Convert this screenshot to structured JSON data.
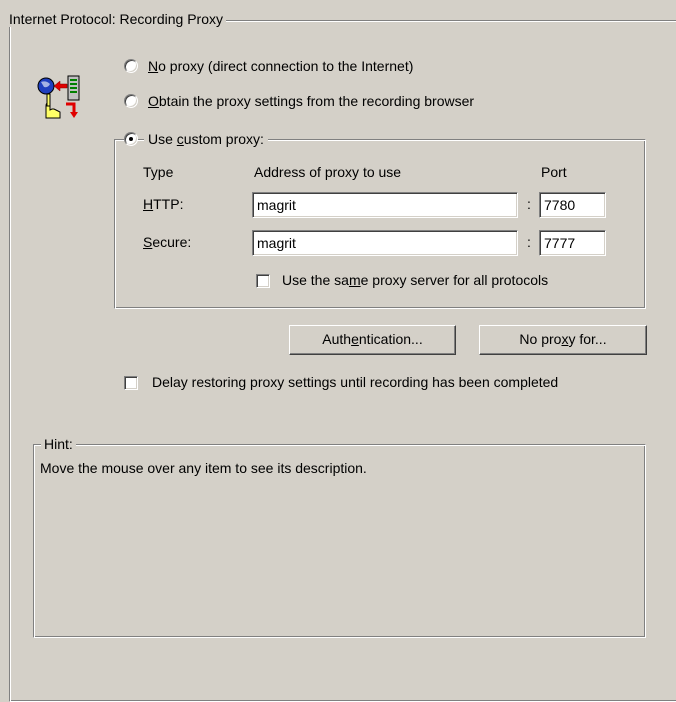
{
  "section": {
    "title": "Internet Protocol: Recording Proxy"
  },
  "icon": {
    "name": "proxy-settings-icon"
  },
  "proxy_mode": {
    "no_proxy": {
      "label_accel": "N",
      "label_rest": "o proxy (direct connection to the Internet)",
      "selected": false
    },
    "obtain_from_browser": {
      "label_accel": "O",
      "label_rest": "btain the proxy settings from the recording browser",
      "selected": false
    },
    "custom": {
      "label_prefix": "Use ",
      "label_accel": "c",
      "label_rest": "ustom proxy:",
      "selected": true
    }
  },
  "custom_proxy": {
    "headers": {
      "type": "Type",
      "address": "Address of proxy to use",
      "port": "Port"
    },
    "rows": [
      {
        "type_accel": "H",
        "type_rest": "TTP:",
        "address": "magrit",
        "separator": ":",
        "port": "7780"
      },
      {
        "type_accel": "S",
        "type_rest": "ecure:",
        "address": "magrit",
        "separator": ":",
        "port": "7777"
      }
    ],
    "same_proxy": {
      "label_prefix": "Use the sa",
      "label_accel": "m",
      "label_rest": "e proxy server for all protocols",
      "checked": false
    }
  },
  "buttons": {
    "authentication": {
      "prefix": "Auth",
      "accel": "e",
      "rest": "ntication..."
    },
    "no_proxy_for": {
      "prefix": "No pro",
      "accel": "x",
      "rest": "y for..."
    }
  },
  "delay_restore": {
    "label": "Delay restoring proxy settings until recording has been completed",
    "checked": false
  },
  "hint": {
    "title": "Hint:",
    "text": "Move the mouse over any item to see its description."
  }
}
